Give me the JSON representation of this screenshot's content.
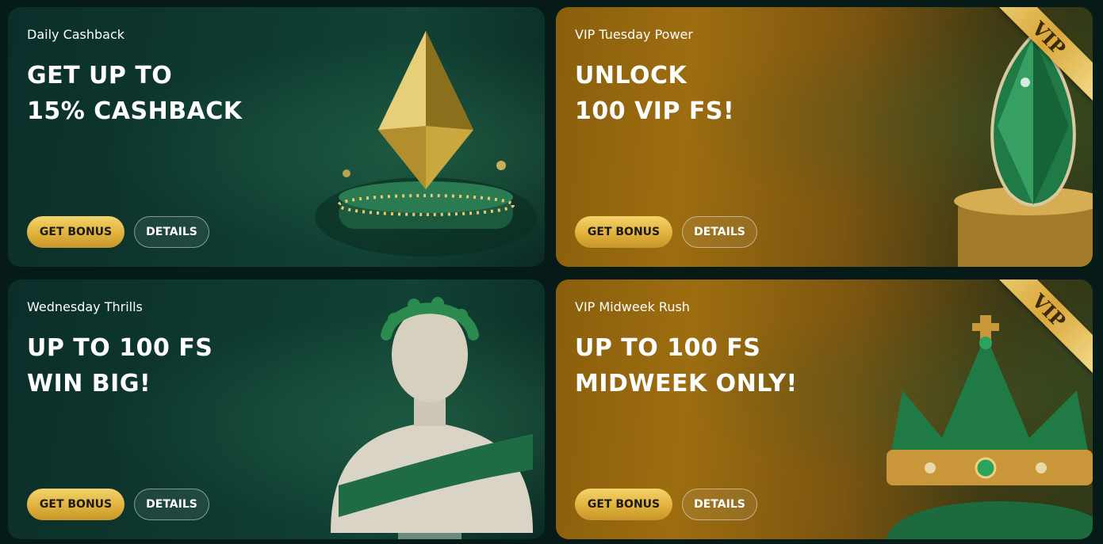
{
  "cards": [
    {
      "subtitle": "Daily Cashback",
      "headline_line1": "GET UP TO",
      "headline_line2": "15% CASHBACK",
      "get_bonus_label": "GET BONUS",
      "details_label": "DETAILS",
      "art_icon": "emerald-gem-icon"
    },
    {
      "subtitle": "VIP Tuesday Power",
      "headline_line1": "UNLOCK",
      "headline_line2": "100 VIP FS!",
      "get_bonus_label": "GET BONUS",
      "details_label": "DETAILS",
      "badge": "VIP",
      "art_icon": "green-diamond-icon"
    },
    {
      "subtitle": "Wednesday Thrills",
      "headline_line1": "UP TO 100 FS",
      "headline_line2": "WIN BIG!",
      "get_bonus_label": "GET BONUS",
      "details_label": "DETAILS",
      "art_icon": "statue-bust-icon"
    },
    {
      "subtitle": "VIP Midweek Rush",
      "headline_line1": "UP TO 100 FS",
      "headline_line2": "MIDWEEK ONLY!",
      "get_bonus_label": "GET BONUS",
      "details_label": "DETAILS",
      "badge": "VIP",
      "art_icon": "crown-icon"
    }
  ],
  "colors": {
    "page_bg": "#061a17",
    "green_card": "#0e3a31",
    "gold_card": "#9d6d10",
    "button_gold": "#e0b23c",
    "text": "#ffffff"
  }
}
